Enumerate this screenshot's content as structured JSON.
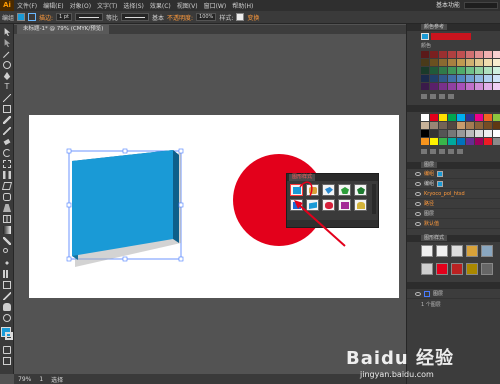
{
  "app": {
    "logo": "Ai"
  },
  "menubar": {
    "items": [
      "文件(F)",
      "编辑(E)",
      "对象(O)",
      "文字(T)",
      "选择(S)",
      "效果(C)",
      "视图(V)",
      "窗口(W)",
      "帮助(H)"
    ],
    "workspace": "基本功能"
  },
  "controlbar": {
    "selection_label": "编组",
    "stroke_label": "描边:",
    "stroke_weight": "1 pt",
    "uniform_label": "等比",
    "basic_label": "基本",
    "opacity_label": "不透明度:",
    "opacity_value": "100%",
    "style_label": "样式:",
    "transform_label": "变换"
  },
  "document": {
    "tab_title": "未标题-1* @ 79% (CMYK/预览)"
  },
  "statusbar": {
    "zoom": "79%",
    "page": "1",
    "tool_label": "选择"
  },
  "panels": {
    "swatches_tab": "颜色参考",
    "color_group_label": "颜色",
    "layers": [
      {
        "name": "编组"
      },
      {
        "name": "编组"
      },
      {
        "name": "Kryoco_pol_htsd"
      },
      {
        "name": "路径"
      },
      {
        "name": "图层"
      },
      {
        "name": "默认值"
      }
    ],
    "graphic_styles_tab": "图形样式",
    "layers_tab": "图层",
    "layer_count": "1 个图层"
  },
  "floatpanel": {
    "title": "图形样式"
  },
  "watermark": {
    "brand": "Baidu 经验",
    "url": "jingyan.baidu.com"
  },
  "colors": {
    "canvas_bg": "#535353",
    "blue_rect": "#1a9ad6",
    "red_circle": "#e3001b",
    "arrow": "#e3001b"
  }
}
